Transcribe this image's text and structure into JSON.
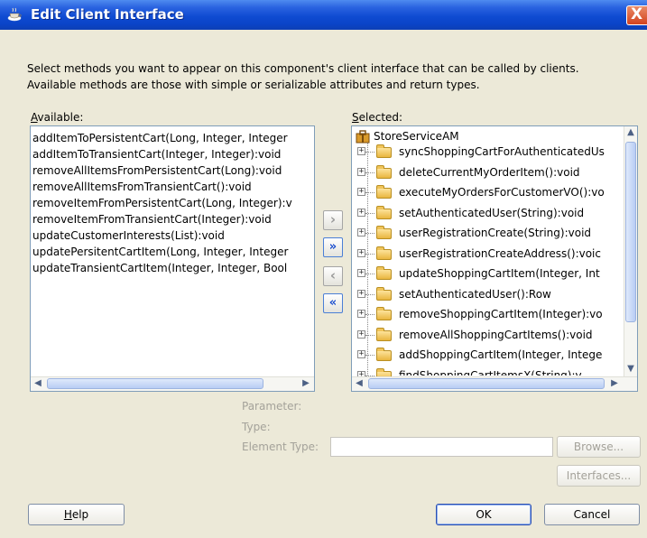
{
  "window": {
    "title": "Edit Client Interface",
    "close_glyph": "X"
  },
  "instructions": {
    "line1": "Select methods you want to appear on this component's client interface that can be called by clients.",
    "line2": "Available methods are those with simple or serializable attributes and return types."
  },
  "available": {
    "label_mnemonic": "A",
    "label_rest": "vailable:",
    "items": [
      "addItemToPersistentCart(Long, Integer, Integer",
      "addItemToTransientCart(Integer, Integer):void",
      "removeAllItemsFromPersistentCart(Long):void",
      "removeAllItemsFromTransientCart():void",
      "removeItemFromPersistentCart(Long, Integer):v",
      "removeItemFromTransientCart(Integer):void",
      "updateCustomerInterests(List):void",
      "updatePersitentCartItem(Long, Integer, Integer",
      "updateTransientCartItem(Integer, Integer, Bool"
    ]
  },
  "shuttle": {
    "add": "›",
    "add_all": "»",
    "remove": "‹",
    "remove_all": "«"
  },
  "selected": {
    "label_mnemonic": "S",
    "label_rest": "elected:",
    "root": "StoreServiceAM",
    "items": [
      "syncShoppingCartForAuthenticatedUs",
      "deleteCurrentMyOrderItem():void",
      "executeMyOrdersForCustomerVO():vo",
      "setAuthenticatedUser(String):void",
      "userRegistrationCreate(String):void",
      "userRegistrationCreateAddress():voic",
      "updateShoppingCartItem(Integer, Int",
      "setAuthenticatedUser():Row",
      "removeShoppingCartItem(Integer):vo",
      "removeAllShoppingCartItems():void",
      "addShoppingCartItem(Integer, Intege"
    ],
    "partial_item": "findShoppingCartItemsX(String):v"
  },
  "details": {
    "parameter_label": "Parameter:",
    "type_label": "Type:",
    "element_type_label": "Element Type:",
    "element_type_value": "",
    "browse_label": "Browse...",
    "interfaces_label": "Interfaces..."
  },
  "buttons": {
    "help_mnemonic": "H",
    "help_rest": "elp",
    "ok_label": "OK",
    "cancel_label": "Cancel"
  },
  "icons": {
    "title": "coffee-cup-icon",
    "root": "application-module-icon",
    "folder": "folder-icon",
    "expand": "plus-icon"
  },
  "colors": {
    "titlebar": "#0f4bd2",
    "dialog_bg": "#ece9d8",
    "close_button": "#d3431f",
    "listbox_border": "#7f9db9"
  }
}
